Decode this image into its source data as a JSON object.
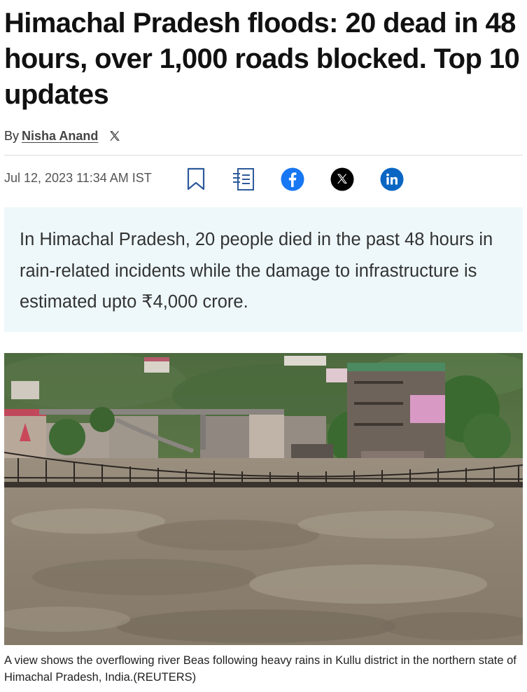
{
  "article": {
    "headline": "Himachal Pradesh floods: 20 dead in 48 hours, over 1,000 roads blocked. Top 10 updates",
    "byline_prefix": "By",
    "author": "Nisha Anand",
    "timestamp": "Jul 12, 2023 11:34 AM IST",
    "summary": "In Himachal Pradesh, 20 people died in the past 48 hours in rain-related incidents while the damage to infrastructure is estimated upto ₹4,000 crore.",
    "photo_caption": "A view shows the overflowing river Beas following heavy rains in Kullu district in the northern state of Himachal Pradesh, India.(REUTERS)"
  },
  "share": {
    "bookmark_icon": "bookmark-icon",
    "notes_icon": "notes-icon",
    "facebook_icon": "facebook-icon",
    "x_icon": "x-icon",
    "linkedin_icon": "linkedin-icon",
    "facebook_letter": "f",
    "x_letter": "𝕏",
    "linkedin_letters": "in"
  },
  "colors": {
    "facebook": "#1877f2",
    "linkedin": "#0a66c2",
    "x": "#000000",
    "summary_bg": "#eef8fb",
    "icon_stroke": "#2d5a9a"
  }
}
